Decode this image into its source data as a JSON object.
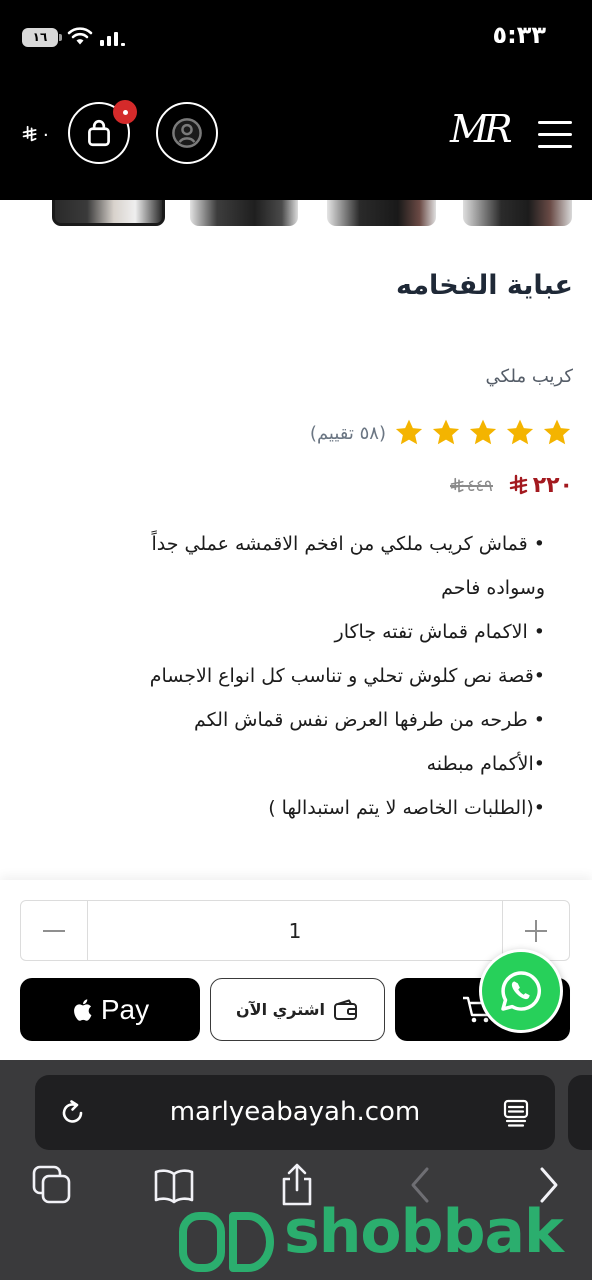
{
  "status_bar": {
    "time": "٥:٣٣",
    "battery_level": "١٦",
    "icons": [
      "wifi-icon",
      "signal-icon"
    ]
  },
  "header": {
    "logo_text": "MR",
    "cart_total": "٠",
    "icons": [
      "menu-icon",
      "user-icon",
      "bag-icon",
      "riyal-icon"
    ],
    "badge_color": "#d42a2a"
  },
  "product": {
    "title": "عباية الفخامه",
    "subtitle": "كريب ملكي",
    "rating": {
      "stars": 5,
      "out_of": 5,
      "count_text": "(٥٨ تقييم)"
    },
    "price": {
      "current": "٢٢٠",
      "original": "٤٤٩",
      "currency_icon": "riyal-icon"
    },
    "description_lines": [
      "• قماش كريب ملكي من افخم الاقمشه عملي جداً",
      "وسواده فاحم",
      "• الاكمام قماش تفته جاكار",
      "•قصة نص كلوش تحلي و تناسب كل انواع الاجسام",
      "• طرحه من طرفها العرض نفس قماش الكم",
      "•الأكمام مبطنه",
      "•(الطلبات الخاصه لا يتم استبدالها )"
    ]
  },
  "purchase": {
    "quantity": "1",
    "apple_pay_label": "Pay",
    "buy_now_label": "اشتري الآن",
    "icons": [
      "minus-icon",
      "plus-icon",
      "apple-icon",
      "wallet-icon",
      "cart-icon",
      "whatsapp-icon"
    ]
  },
  "browser": {
    "url": "marlyeabayah.com",
    "icons": [
      "reload-icon",
      "reader-icon",
      "tabs-icon",
      "bookmarks-icon",
      "share-icon",
      "back-icon",
      "forward-icon"
    ]
  },
  "watermark": {
    "text": "shobbak"
  },
  "colors": {
    "price_red": "#a3191f",
    "star": "#f4b400",
    "whatsapp": "#27d05a",
    "watermark": "#2ab973",
    "header_bg": "#000000",
    "browser_bg": "#3a3a3c"
  }
}
